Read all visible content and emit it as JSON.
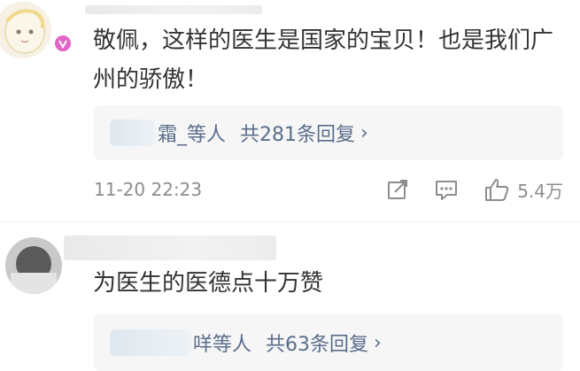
{
  "comments": [
    {
      "text": "敬佩，这样的医生是国家的宝贝！也是我们广州的骄傲！",
      "reply_summary": {
        "names": "霜_等人",
        "count": "共281条回复"
      },
      "timestamp": "11-20 22:23",
      "like_count": "5.4万",
      "icons": [
        "share-icon",
        "comment-icon",
        "like-icon"
      ]
    },
    {
      "text": "为医生的医德点十万赞",
      "reply_summary": {
        "names": "咩等人",
        "count": "共63条回复"
      }
    }
  ],
  "colors": {
    "text": "#333333",
    "link": "#5a6e8c",
    "meta": "#8d8d8d",
    "reply_bg": "#f6f6f6",
    "vip_badge": "#e066c8"
  }
}
